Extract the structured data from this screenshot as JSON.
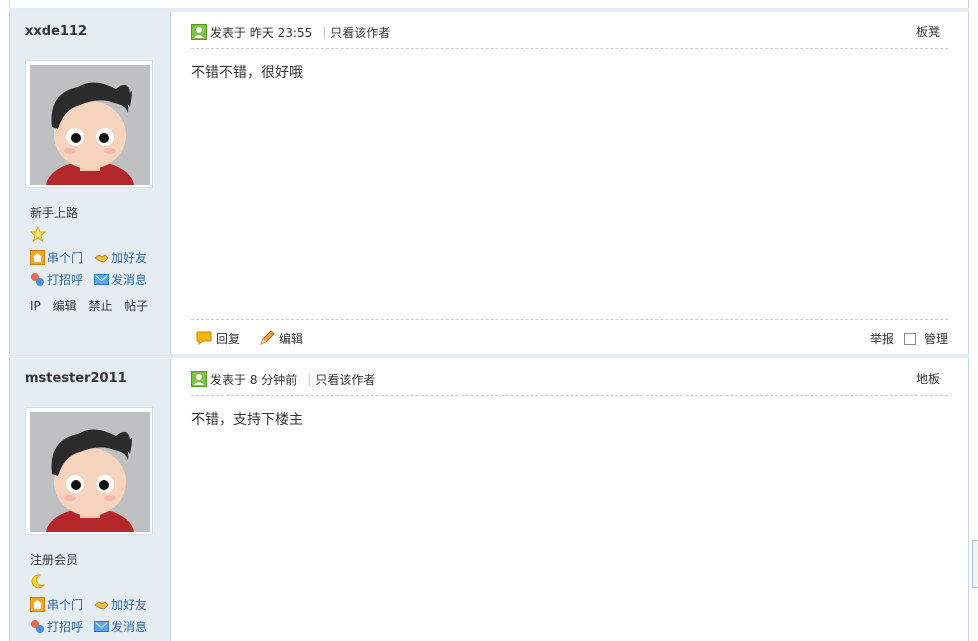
{
  "posts": [
    {
      "username": "xxde112",
      "group": "新手上路",
      "rank_icon": "star-icon",
      "actions": [
        "串个门",
        "加好友",
        "打招呼",
        "发消息"
      ],
      "admin_links": [
        "IP",
        "编辑",
        "禁止",
        "帖子"
      ],
      "posted_prefix": "发表于",
      "posted_time": "昨天 23:55",
      "author_only": "只看该作者",
      "floor": "板凳",
      "message": "不错不错，很好哦",
      "footer": {
        "reply": "回复",
        "edit": "编辑",
        "report": "举报",
        "manage": "管理"
      }
    },
    {
      "username": "mstester2011",
      "group": "注册会员",
      "rank_icon": "moon-icon",
      "actions": [
        "串个门",
        "加好友",
        "打招呼",
        "发消息"
      ],
      "posted_prefix": "发表于",
      "posted_time": "8 分钟前",
      "author_only": "只看该作者",
      "floor": "地板",
      "message": "不错，支持下楼主"
    }
  ],
  "colors": {
    "link": "#336699",
    "sidebar_bg": "#e5edf2",
    "separator": "#e3ecf4"
  }
}
